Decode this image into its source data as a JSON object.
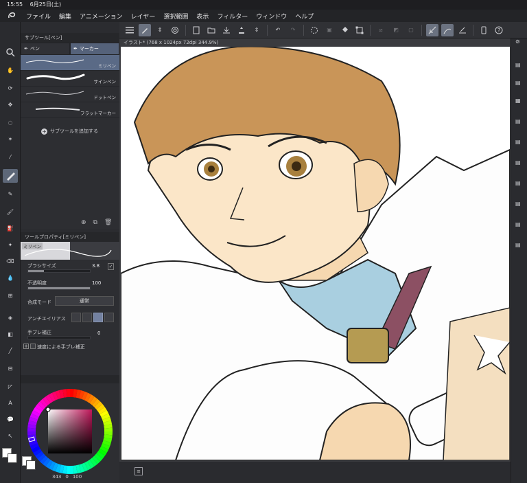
{
  "status": {
    "time": "15:55",
    "date": "6月25日(土)"
  },
  "menu": [
    "ファイル",
    "編集",
    "アニメーション",
    "レイヤー",
    "選択範囲",
    "表示",
    "フィルター",
    "ウィンドウ",
    "ヘルプ"
  ],
  "subtool_panel": {
    "title": "サブツール[ペン]",
    "tabs": [
      "ペン",
      "マーカー"
    ],
    "brushes": [
      "ミリペン",
      "サインペン",
      "ドットペン",
      "フラットマーカー"
    ],
    "add_label": "サブツールを追加する"
  },
  "tool_property": {
    "title": "ツールプロパティ[ミリペン]",
    "preview_label": "ミリペン",
    "brush_size_label": "ブラシサイズ",
    "brush_size": "3.8",
    "brush_size_fraction": 0.25,
    "opacity_label": "不透明度",
    "opacity": "100",
    "opacity_fraction": 1.0,
    "blend_label": "合成モード",
    "blend_value": "通常",
    "aa_label": "アンチエイリアス",
    "stabilize_label": "手ブレ補正",
    "stabilize_value": "0",
    "speed_label": "速度による手ブレ補正"
  },
  "color_panel": {
    "hue": "343",
    "saturation": "0",
    "value": "100"
  },
  "canvas": {
    "tab_label": "イラスト* (768 x 1024px 72dpi 344.9%)"
  },
  "colors": {
    "accent": "#5a6a86",
    "canvas": "#ffffff"
  }
}
